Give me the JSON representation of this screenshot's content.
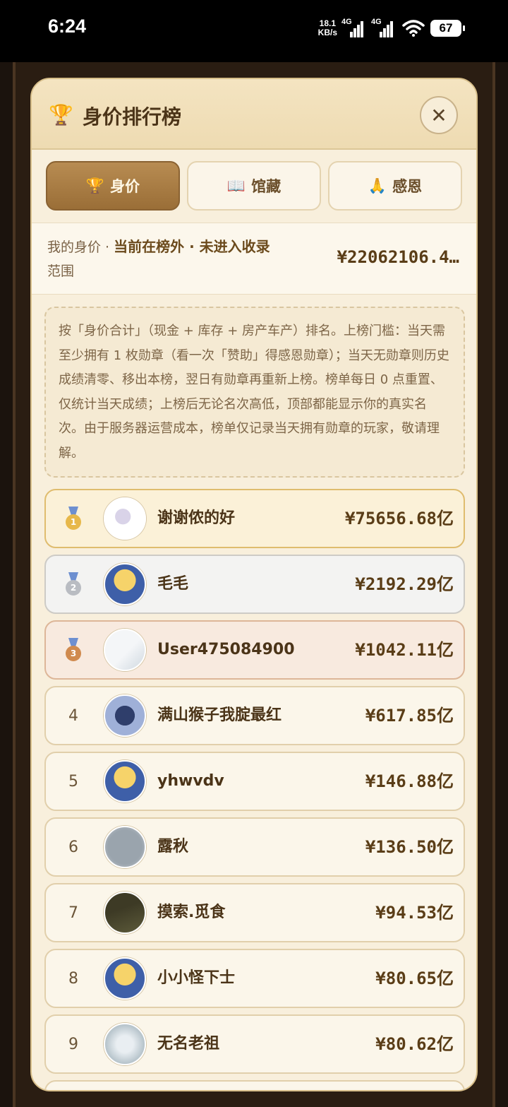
{
  "status_bar": {
    "time": "6:24",
    "net_speed_value": "18.1",
    "net_speed_unit": "KB/s",
    "sim1": "4G",
    "sim2": "4G",
    "battery": "67"
  },
  "modal": {
    "title": "身价排行榜",
    "header_icon": "trophy-icon",
    "close_icon": "close-icon"
  },
  "tabs": [
    {
      "icon": "🏆",
      "label": "身价",
      "active": true
    },
    {
      "icon": "📖",
      "label": "馆藏",
      "active": false
    },
    {
      "icon": "🙏",
      "label": "感恩",
      "active": false
    }
  ],
  "my_worth": {
    "prefix": "我的身价 · ",
    "status": "当前在榜外 · 未进入收录",
    "status_cont": "范围",
    "value": "¥22062106.4…"
  },
  "notice": "按「身价合计」（现金 + 库存 + 房产车产）排名。上榜门槛：当天需至少拥有 1 枚勋章（看一次「赞助」得感恩勋章）；当天无勋章则历史成绩清零、移出本榜，翌日有勋章再重新上榜。榜单每日 0 点重置、仅统计当天成绩；上榜后无论名次高低，顶部都能显示你的真实名次。由于服务器运营成本，榜单仅记录当天拥有勋章的玩家，敬请理解。",
  "colors": {
    "accent": "#a57a42",
    "panel": "#f8efdc",
    "text_dark": "#4b3418",
    "gold": "#e7b84a",
    "silver": "#b9bcc2",
    "bronze": "#d08a4e"
  },
  "leaderboard": [
    {
      "rank": "1",
      "medal": "gold",
      "name": "谢谢侬的好",
      "value": "¥75656.68亿"
    },
    {
      "rank": "2",
      "medal": "silver",
      "name": "毛毛",
      "value": "¥2192.29亿"
    },
    {
      "rank": "3",
      "medal": "bronze",
      "name": "User475084900",
      "value": "¥1042.11亿"
    },
    {
      "rank": "4",
      "medal": "",
      "name": "满山猴子我腚最红",
      "value": "¥617.85亿"
    },
    {
      "rank": "5",
      "medal": "",
      "name": "yhwvdv",
      "value": "¥146.88亿"
    },
    {
      "rank": "6",
      "medal": "",
      "name": "露秋",
      "value": "¥136.50亿"
    },
    {
      "rank": "7",
      "medal": "",
      "name": "摸索.觅食",
      "value": "¥94.53亿"
    },
    {
      "rank": "8",
      "medal": "",
      "name": "小小怪下士",
      "value": "¥80.65亿"
    },
    {
      "rank": "9",
      "medal": "",
      "name": "无名老祖",
      "value": "¥80.62亿"
    }
  ]
}
